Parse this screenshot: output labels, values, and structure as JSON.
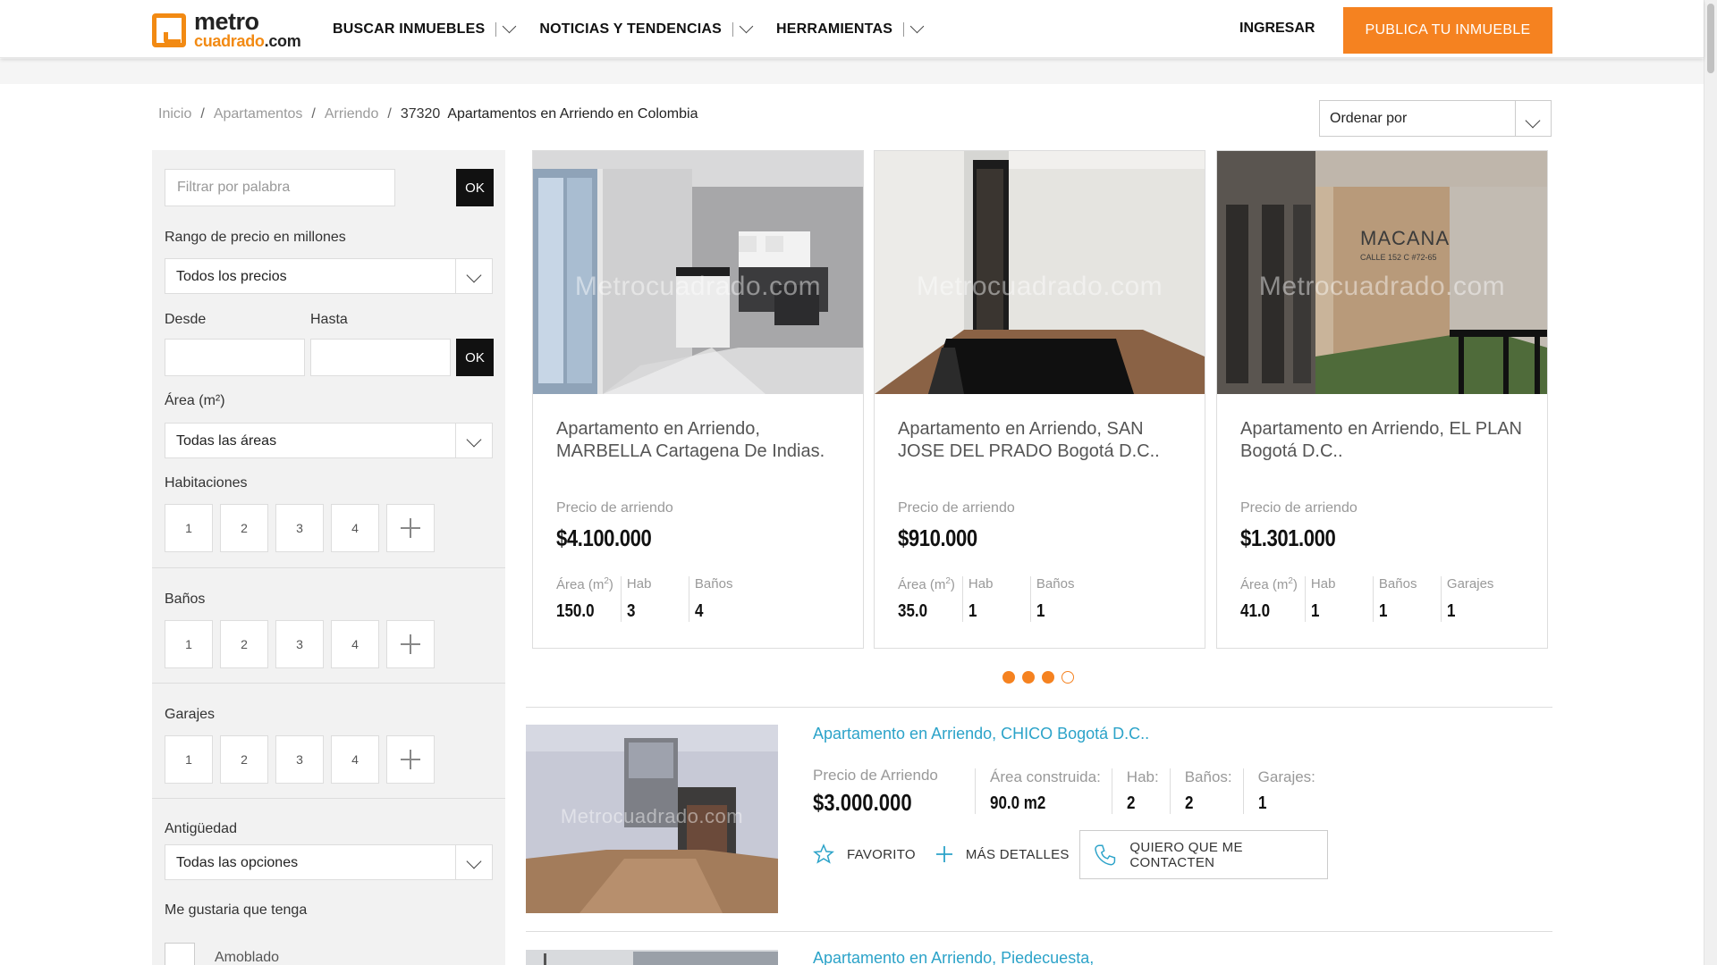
{
  "header": {
    "logo_top": "metro",
    "logo_bottom": "cuadrado",
    "logo_suffix": ".com",
    "nav": [
      "BUSCAR INMUEBLES",
      "NOTICIAS Y TENDENCIAS",
      "HERRAMIENTAS"
    ],
    "login": "INGRESAR",
    "publish": "PUBLICA TU INMUEBLE",
    "accent_color": "#f58220"
  },
  "breadcrumb": {
    "items": [
      "Inicio",
      "Apartamentos",
      "Arriendo"
    ],
    "count": "37320",
    "title": "Apartamentos en Arriendo en Colombia"
  },
  "sort": {
    "label": "Ordenar por"
  },
  "filters": {
    "keyword_placeholder": "Filtrar por palabra",
    "ok": "OK",
    "price_range_label": "Rango de precio en millones",
    "price_select": "Todos los precios",
    "from_label": "Desde",
    "to_label": "Hasta",
    "area_label": "Área (m²)",
    "area_select": "Todas las áreas",
    "rooms_label": "Habitaciones",
    "baths_label": "Baños",
    "garages_label": "Garajes",
    "numbers": [
      "1",
      "2",
      "3",
      "4"
    ],
    "age_label": "Antigüedad",
    "age_select": "Todas las opciones",
    "wish_label": "Me gustaria que tenga",
    "furnished_label": "Amoblado"
  },
  "featured": [
    {
      "title": "Apartamento en Arriendo, MARBELLA Cartagena De Indias.",
      "price_label": "Precio de arriendo",
      "price": "$4.100.000",
      "features": [
        {
          "label": "Área (m",
          "sup": "2",
          "label_end": ")",
          "value": "150.0"
        },
        {
          "label": "Hab",
          "value": "3"
        },
        {
          "label": "Baños",
          "value": "4"
        }
      ]
    },
    {
      "title": "Apartamento en Arriendo, SAN JOSE DEL PRADO Bogotá D.C..",
      "price_label": "Precio de arriendo",
      "price": "$910.000",
      "features": [
        {
          "label": "Área (m",
          "sup": "2",
          "label_end": ")",
          "value": "35.0"
        },
        {
          "label": "Hab",
          "value": "1"
        },
        {
          "label": "Baños",
          "value": "1"
        }
      ]
    },
    {
      "title": "Apartamento en Arriendo, EL PLAN Bogotá D.C..",
      "price_label": "Precio de arriendo",
      "price": "$1.301.000",
      "features": [
        {
          "label": "Área (m",
          "sup": "2",
          "label_end": ")",
          "value": "41.0"
        },
        {
          "label": "Hab",
          "value": "1"
        },
        {
          "label": "Baños",
          "value": "1"
        },
        {
          "label": "Garajes",
          "value": "1"
        }
      ]
    }
  ],
  "watermark": "Metrocuadrado.com",
  "card1_watermark": "Metrocuadrado.com",
  "building_sign": "MACANA",
  "building_sign_sub": "CALLE 152 C #72-65",
  "carousel": {
    "dots": 4,
    "active": 3
  },
  "listings": [
    {
      "title": "Apartamento en Arriendo, CHICO Bogotá D.C..",
      "price_label": "Precio de Arriendo",
      "price": "$3.000.000",
      "features": [
        {
          "label": "Área construida:",
          "value": "90.0 m2"
        },
        {
          "label": "Hab:",
          "value": "2"
        },
        {
          "label": "Baños:",
          "value": "2"
        },
        {
          "label": "Garajes:",
          "value": "1"
        }
      ],
      "favorite": "FAVORITO",
      "more": "MÁS DETALLES",
      "contact": "QUIERO QUE ME CONTACTEN"
    },
    {
      "title": "Apartamento en Arriendo, Piedecuesta,"
    }
  ]
}
